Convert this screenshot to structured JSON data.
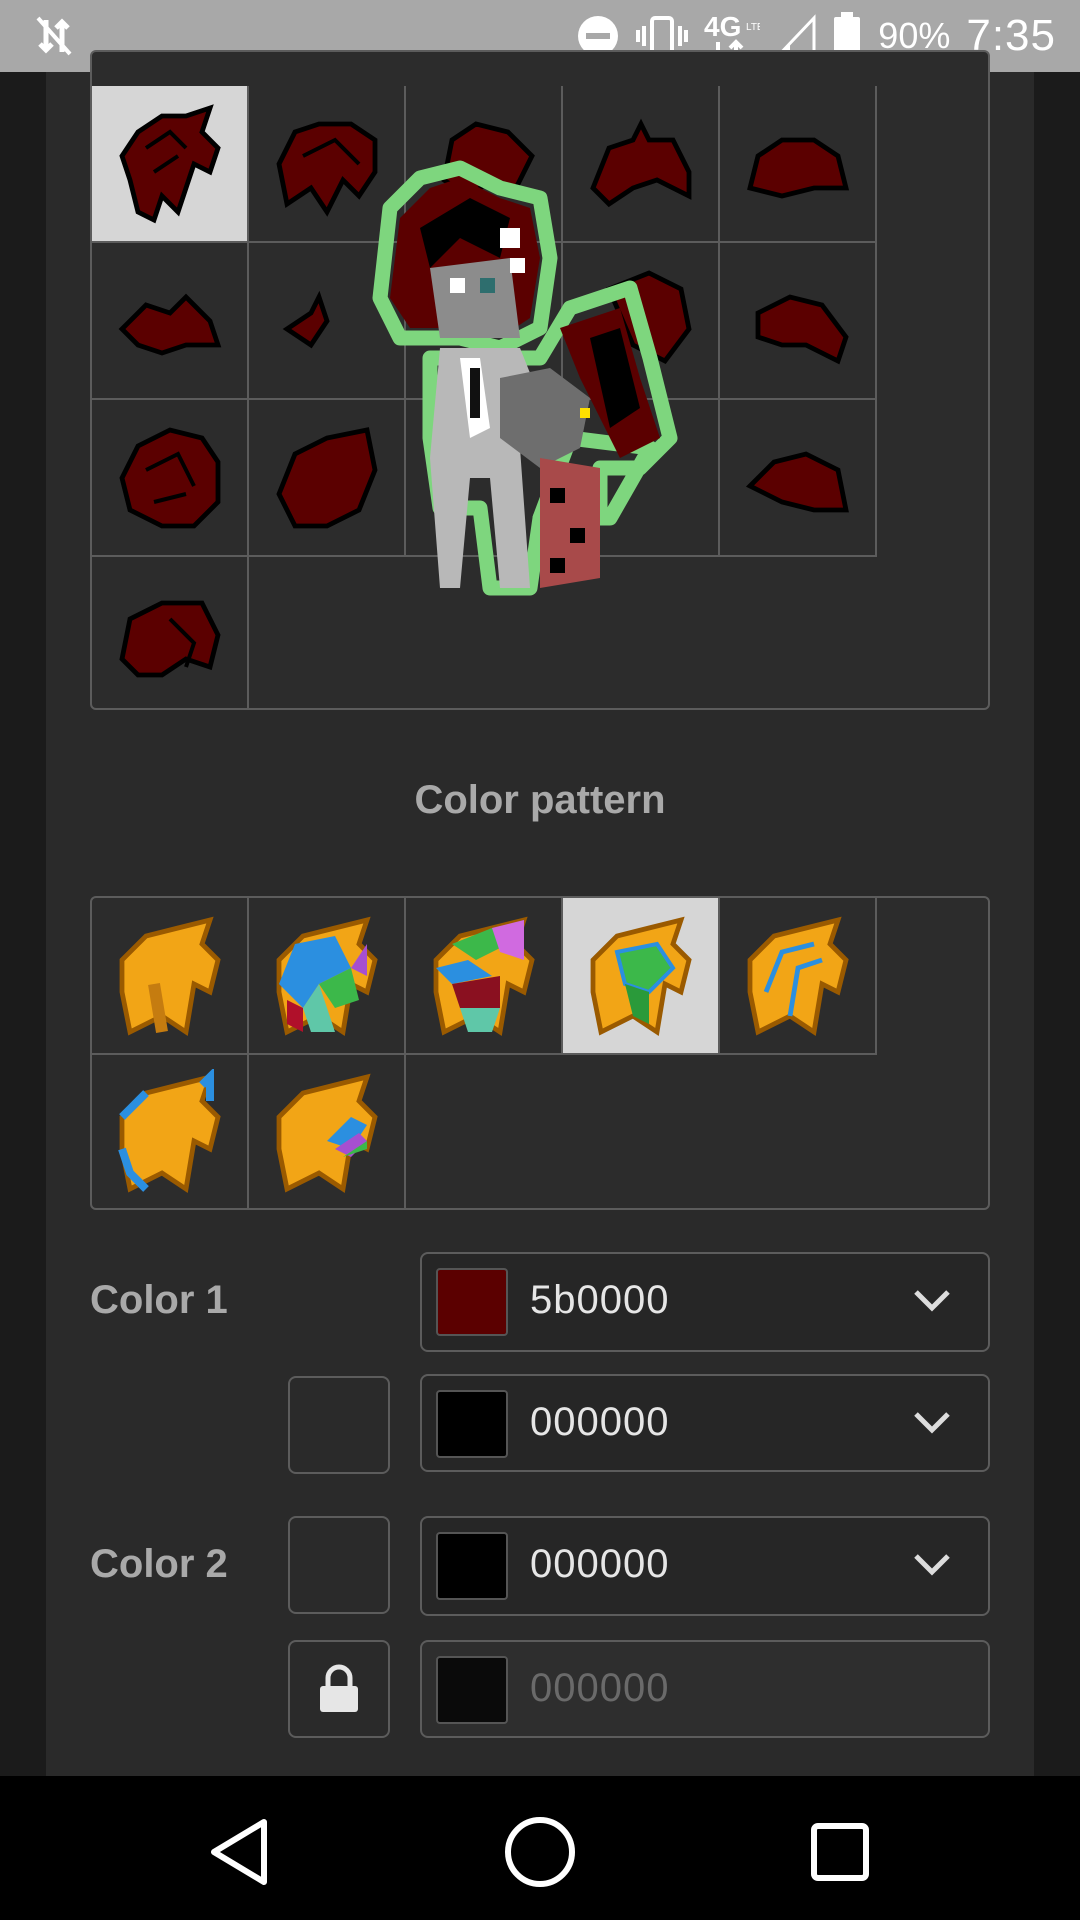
{
  "status_bar": {
    "battery_percent": "90%",
    "time": "7:35",
    "network": "4G LTE",
    "icons": [
      "sync-off-icon",
      "do-not-disturb-icon",
      "vibrate-icon",
      "network-4g-lte-icon",
      "signal-icon",
      "battery-icon"
    ]
  },
  "hair_grid": {
    "selected_index": 0,
    "color": "#5b0000",
    "outline": "#000000"
  },
  "preview": {
    "outline_color": "#7ed67e"
  },
  "color_pattern": {
    "title": "Color pattern",
    "selected_index": 3,
    "count": 7
  },
  "colors": {
    "color1_label": "Color 1",
    "color1_value": "5b0000",
    "color1_swatch": "#5b0000",
    "color1_outline_value": "000000",
    "color1_outline_swatch": "#000000",
    "color2_label": "Color 2",
    "color2_value": "000000",
    "color2_swatch": "#000000",
    "color2_outline_value": "000000",
    "color2_outline_swatch": "#0a0a0a",
    "lock_icon": "lock-icon",
    "dropdown_icon": "chevron-down-icon"
  },
  "nav": {
    "back_icon": "back-triangle-icon",
    "home_icon": "home-circle-icon",
    "recents_icon": "recents-square-icon"
  }
}
